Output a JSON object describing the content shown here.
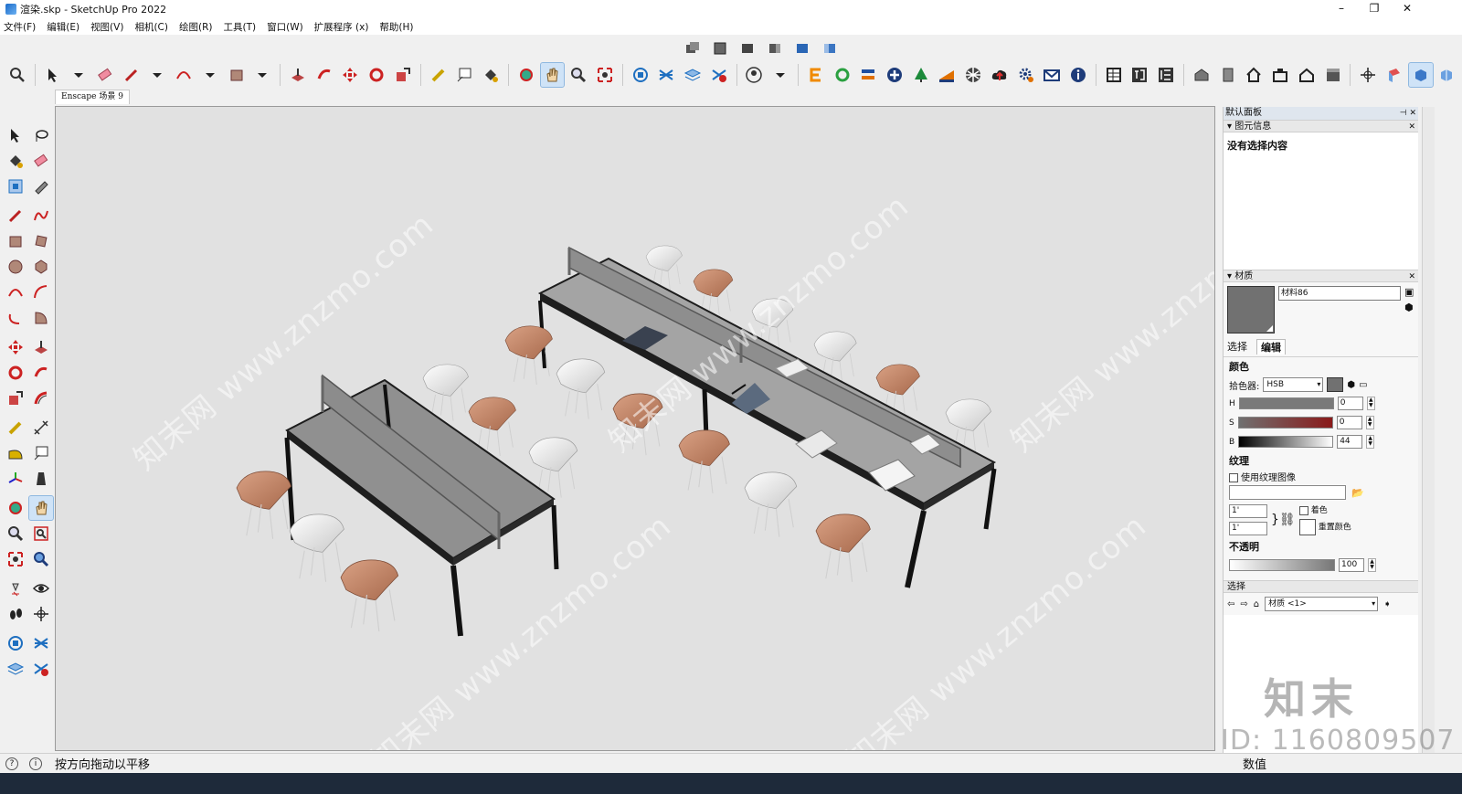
{
  "window": {
    "title": "渲染.skp - SketchUp Pro 2022",
    "minimize": "–",
    "maximize": "❐",
    "close": "✕"
  },
  "menu": [
    "文件(F)",
    "编辑(E)",
    "视图(V)",
    "相机(C)",
    "绘图(R)",
    "工具(T)",
    "窗口(W)",
    "扩展程序 (x)",
    "帮助(H)"
  ],
  "scene_tab": "Enscape 场景 9",
  "tray": {
    "title": "默认面板",
    "entity_info": {
      "header": "图元信息",
      "empty_text": "没有选择内容"
    },
    "materials": {
      "header": "材质",
      "material_name": "材料86",
      "swatch_color": "#717171",
      "tabs": [
        "选择",
        "编辑"
      ],
      "active_tab": "编辑",
      "color_heading": "颜色",
      "picker_label": "拾色器:",
      "picker_value": "HSB",
      "h_label": "H",
      "h_value": "0",
      "s_label": "S",
      "s_value": "0",
      "b_label": "B",
      "b_value": "44",
      "texture_heading": "纹理",
      "use_texture_label": "使用纹理图像",
      "tex_w": "1'",
      "tex_h": "1'",
      "colorize_label": "着色",
      "reset_color_label": "重置颜色",
      "opacity_heading": "不透明",
      "opacity_value": "100"
    },
    "select": {
      "header": "选择",
      "dropdown": "材质 <1>"
    }
  },
  "watermark_brand": "知末",
  "watermark_text": "知末网 www.znzmo.com",
  "id_text": "ID: 1160809507",
  "status": {
    "message": "按方向拖动以平移",
    "measure_label": "数值"
  }
}
